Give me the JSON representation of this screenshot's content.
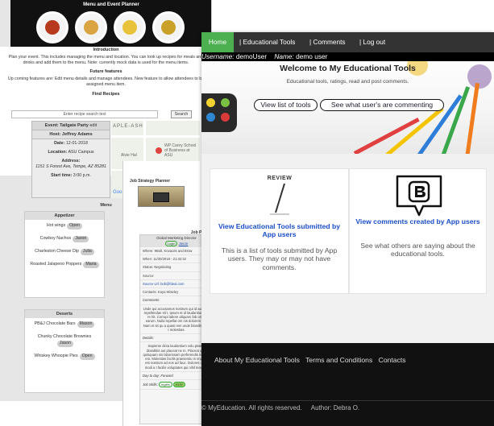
{
  "planner": {
    "hero_title": "Menu and Event Planner",
    "intro_title": "Introduction",
    "intro_text": "Plan your event. This includes managing the menu and location. You can look up recipes for meals and drinks and add them to the menu. Note: currently mock data is used for the menu items.",
    "future_title": "Future features",
    "future_text": "Up coming features are: Edit menu details and manage attendees. New feature to allow attendees to be assigned menu item.",
    "find_title": "Find Recipes",
    "search_placeholder": "Enter recipe search text",
    "search_button": "Search",
    "event": {
      "title": "Event: Tailgate Party",
      "edit": "edit",
      "host": "Host: Jeffrey Adams",
      "date_label": "Date:",
      "date": "12-01-2018",
      "location_label": "Location:",
      "location": "ASU Campus",
      "address_label": "Address:",
      "address": "1151 S Forest Ave, Tempe, AZ 85281",
      "start_label": "Start time:",
      "start": "3:00 p.m."
    },
    "map_labels": [
      "APLE-ASH",
      "WP Carey School of Business at ASU",
      "Alvie Hal",
      "Goo"
    ],
    "menu_title": "Menu",
    "appetizer": {
      "title": "Appetizer",
      "items": [
        {
          "name": "Hot wings",
          "tag": "Open"
        },
        {
          "name": "Cowboy Nachos",
          "tag": "Jason"
        },
        {
          "name": "Charleston Cheese Dip",
          "tag": "Julia"
        },
        {
          "name": "Roasted Jalapeno Poppers",
          "tag": "Maria"
        }
      ]
    },
    "desserts": {
      "title": "Deserts",
      "items": [
        {
          "name": "PB&J Chocolate Bars",
          "tag": "Mason"
        },
        {
          "name": "Chunky Chocolate Brownies",
          "tag": "Jason"
        },
        {
          "name": "Whiskey Whoopie Pies",
          "tag": "Open"
        }
      ]
    }
  },
  "job": {
    "title": "Job Strategy Planner",
    "prospects": "Job Prospe",
    "card_title": "Global Marketing Director",
    "card_links": [
      "Login",
      "Jason"
    ],
    "lines": [
      "Where: 9Bolt, Kovacek and Brow",
      "When: 11/30/2018 - 21:32:32",
      "Status: Negotiating",
      "Source:",
      "Source Url: bob@fdeal.com",
      "Contacts: Kaya Wiseley",
      "Comments:",
      "Unde qui accusamus nostrum qui id aut vero repellendae sit t. Ipsum et id laudantium est re hit. Corrupi labore aliquam fab orum earum. Nulla repellat om nis dolorem aut. Nam et sit qu a quasi rem unde blanditiis odi t molestias.",
      "Details:",
      "Sapiente dicta laudantium volu ptatem blanditiis aut placeat ne m. Placeat quia quisquam nis laboriosam perferendis iste aut em. Molestias facilis praesentiu m impedit est nostrum ad eos ad fauc. Dolores unde modi a t facilis voluptates qui nihil tene tur.",
      "Day to day: Forward",
      "Job Skills:"
    ],
    "skills": [
      "Inglés",
      "ROR"
    ]
  },
  "edu": {
    "nav": [
      {
        "label": "Home"
      },
      {
        "label": "| Educational Tools"
      },
      {
        "label": "| Comments"
      },
      {
        "label": "| Log out"
      }
    ],
    "username_label": "Username:",
    "username": "demoUser",
    "name_label": "Name:",
    "name": "demo user",
    "hero_title": "Welcome to My Educational Tools",
    "hero_sub": "Educational tools, ratings, read and post comments.",
    "btn_tools": "View list of tools",
    "btn_comments": "See what user's are commenting",
    "review_badge": "REVIEW",
    "card_tools_title": "View Educational Tools submitted by App users",
    "card_tools_desc": "This is a list of tools submitted by App users. They may or may not have comments.",
    "card_comments_title": "View comments created by App users",
    "card_comments_desc": "See what others are saying about the educational tools.",
    "footer_links": [
      "About My Educational Tools",
      "Terms and Conditions",
      "Contacts"
    ],
    "copyright": "© MyEducation. All rights reserved.",
    "author": "Author: Debra O."
  },
  "colors": {
    "nav_bg": "#333333",
    "home_green": "#4caf50",
    "link_blue": "#1a4ec8",
    "footer_bg": "#111111"
  }
}
